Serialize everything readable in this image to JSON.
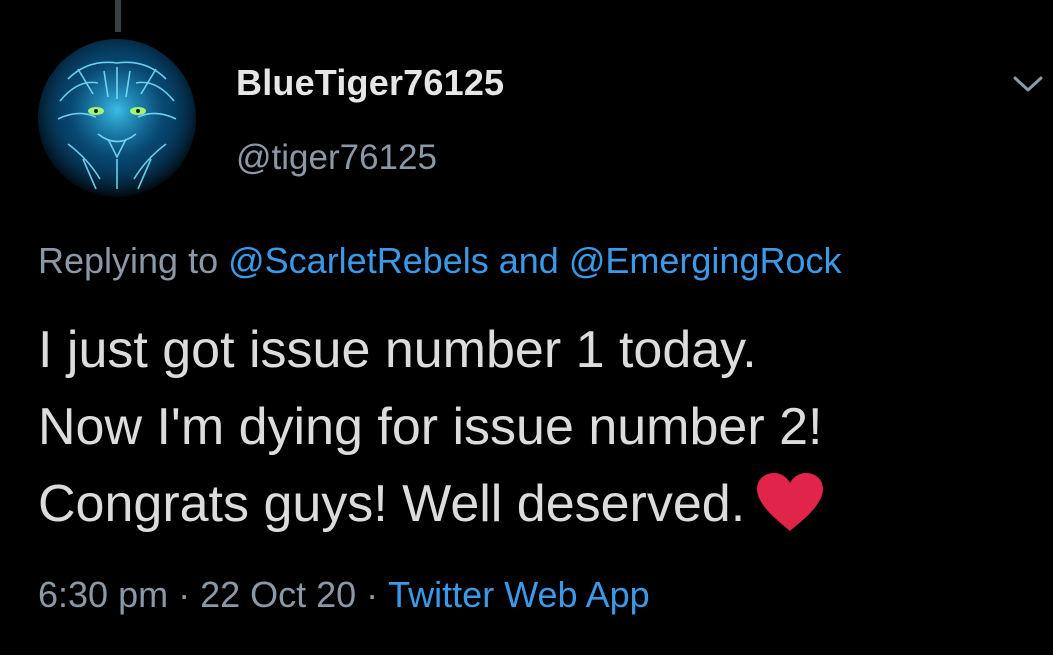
{
  "tweet": {
    "author": {
      "display_name": "BlueTiger76125",
      "handle": "@tiger76125",
      "avatar_icon": "tiger-icon"
    },
    "menu_icon": "chevron-down-icon",
    "reply": {
      "prefix": "Replying to ",
      "mention_1": "@ScarletRebels",
      "conjunction": " and ",
      "mention_2": "@EmergingRock"
    },
    "text_lines": [
      "I just got issue number 1 today.",
      "Now I'm dying for issue number 2!",
      "Congrats guys! Well deserved."
    ],
    "emoji": "heart-icon",
    "meta": {
      "time": "6:30 pm",
      "separator": "·",
      "date": "22 Oct 20",
      "source": "Twitter Web App"
    }
  },
  "colors": {
    "background": "#000000",
    "link": "#3a9ae8",
    "muted": "#8b98a5",
    "heart": "#e0244a"
  }
}
